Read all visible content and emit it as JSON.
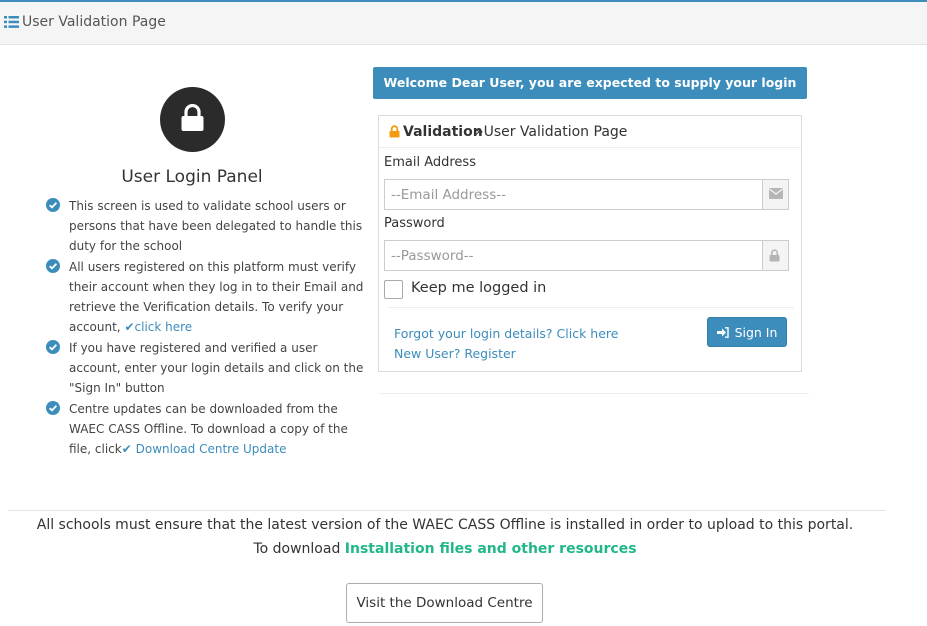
{
  "header": {
    "title": "User Validation Page",
    "icon": "list-icon"
  },
  "left_panel": {
    "title": "User Login Panel",
    "items": [
      {
        "text": "This screen is used to validate school users or persons that have been delegated to handle this duty for the school"
      },
      {
        "text": "All users registered on this platform must verify their account when they log in to their Email and retrieve the Verification details. To verify your account,",
        "link": "click here"
      },
      {
        "text": "If you have registered and verified a user account, enter your login details and click on the \"Sign In\" button"
      },
      {
        "text": "Centre updates can be downloaded from the WAEC CASS Offline. To download a copy of the file, click",
        "link": "Download Centre Update"
      }
    ]
  },
  "welcome_banner": "Welcome Dear User, you are expected to supply your login details",
  "login": {
    "heading_bold": "Validation",
    "heading_crumb": "»User Validation Page",
    "email_label": "Email Address",
    "email_placeholder": "--Email Address--",
    "password_label": "Password",
    "password_placeholder": "--Password--",
    "remember_label": "Keep me logged in",
    "forgot_link": "Forgot your login details? Click here",
    "register_link": "New User? Register",
    "signin_label": "Sign In"
  },
  "notice": {
    "line1": "All schools must ensure that the latest version of the WAEC CASS Offline is installed in order to upload to this portal.",
    "line2_prefix": "To download",
    "line2_link": "Installation files and other resources"
  },
  "download_button": "Visit the Download Centre",
  "colors": {
    "primary": "#3c8dbc",
    "green_link": "#21b78a",
    "lock_orange": "#f39c12",
    "dark_circle": "#2b2b2b"
  }
}
